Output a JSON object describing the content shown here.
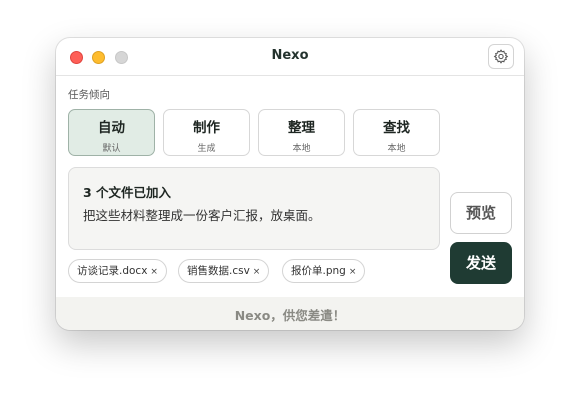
{
  "window": {
    "title": "Nexo"
  },
  "task_section": {
    "label": "任务倾向"
  },
  "modes": [
    {
      "title": "自动",
      "sub": "默认",
      "selected": true
    },
    {
      "title": "制作",
      "sub": "生成",
      "selected": false
    },
    {
      "title": "整理",
      "sub": "本地",
      "selected": false
    },
    {
      "title": "查找",
      "sub": "本地",
      "selected": false
    }
  ],
  "composer": {
    "header": "3 个文件已加入",
    "text": "把这些材料整理成一份客户汇报，放桌面。"
  },
  "buttons": {
    "preview": "预览",
    "send": "发送"
  },
  "attachments": [
    {
      "name": "访谈记录.docx",
      "remove": "×"
    },
    {
      "name": "销售数据.csv",
      "remove": "×"
    },
    {
      "name": "报价单.png",
      "remove": "×"
    }
  ],
  "footer": {
    "text": "Nexo，供您差遣！"
  },
  "colors": {
    "accent": "#1f3b33",
    "selected_bg": "#e1ece5"
  },
  "icons": {
    "settings": "gear-icon"
  }
}
